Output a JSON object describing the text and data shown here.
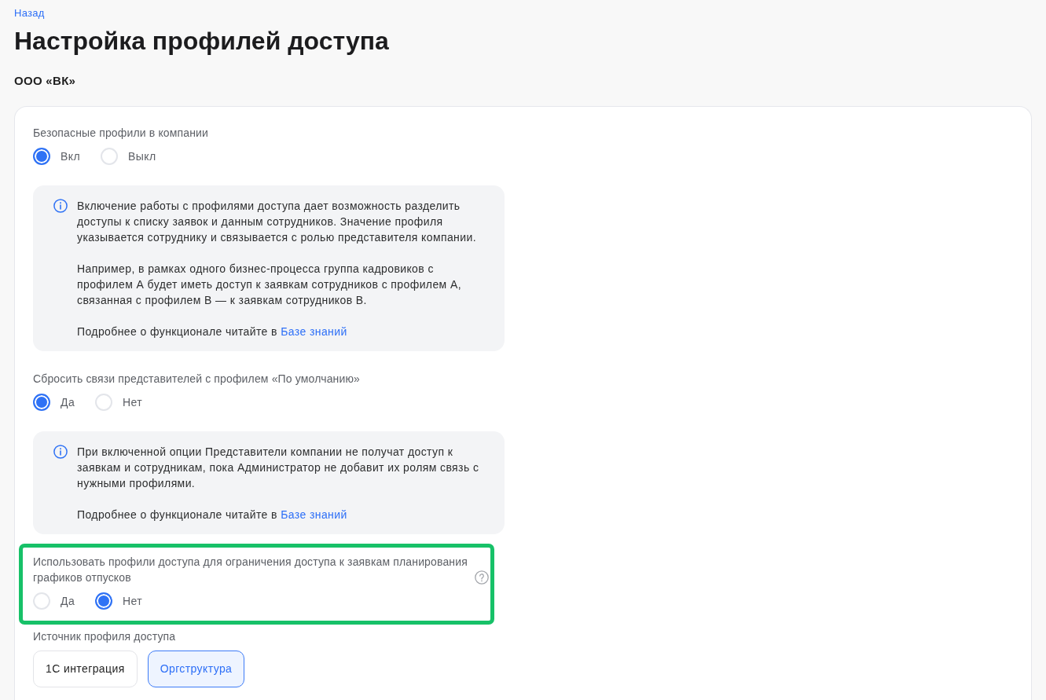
{
  "back_link": "Назад",
  "title": "Настройка профилей доступа",
  "company": "ООО «ВК»",
  "sections": [
    {
      "kind": "radio",
      "label": "Безопасные профили в компании",
      "help": false,
      "highlighted": false,
      "options": [
        {
          "label": "Вкл",
          "selected": true
        },
        {
          "label": "Выкл",
          "selected": false
        }
      ],
      "info": {
        "paragraphs": [
          {
            "text": "Включение работы с профилями доступа дает возможность разделить доступы к списку заявок и данным сотрудников. Значение профиля указывается сотруднику и связывается с ролью представителя компании."
          },
          {
            "text": "Например, в рамках одного бизнес-процесса группа кадровиков с профилем А будет иметь доступ к заявкам сотрудников с профилем А, связанная с профилем В — к заявкам сотрудников В."
          },
          {
            "text": "Подробнее о функционале читайте в",
            "link": "Базе знаний"
          }
        ]
      }
    },
    {
      "kind": "radio",
      "label": "Сбросить связи представителей с профилем «По умолчанию»",
      "help": false,
      "highlighted": false,
      "options": [
        {
          "label": "Да",
          "selected": true
        },
        {
          "label": "Нет",
          "selected": false
        }
      ],
      "info": {
        "paragraphs": [
          {
            "text": "При включенной опции Представители компании не получат доступ к заявкам и сотрудникам, пока Администратор не добавит их ролям связь с нужными профилями."
          },
          {
            "text": "Подробнее о функционале читайте в",
            "link": "Базе знаний"
          }
        ]
      }
    },
    {
      "kind": "radio",
      "label": "Использовать профили доступа для ограничения доступа к заявкам планирования графиков отпусков",
      "help": true,
      "highlighted": true,
      "options": [
        {
          "label": "Да",
          "selected": false
        },
        {
          "label": "Нет",
          "selected": true
        }
      ]
    },
    {
      "kind": "segmented",
      "label": "Источник профиля доступа",
      "help": false,
      "highlighted": false,
      "options": [
        {
          "label": "1С интеграция",
          "selected": false
        },
        {
          "label": "Оргструктура",
          "selected": true
        }
      ]
    }
  ]
}
